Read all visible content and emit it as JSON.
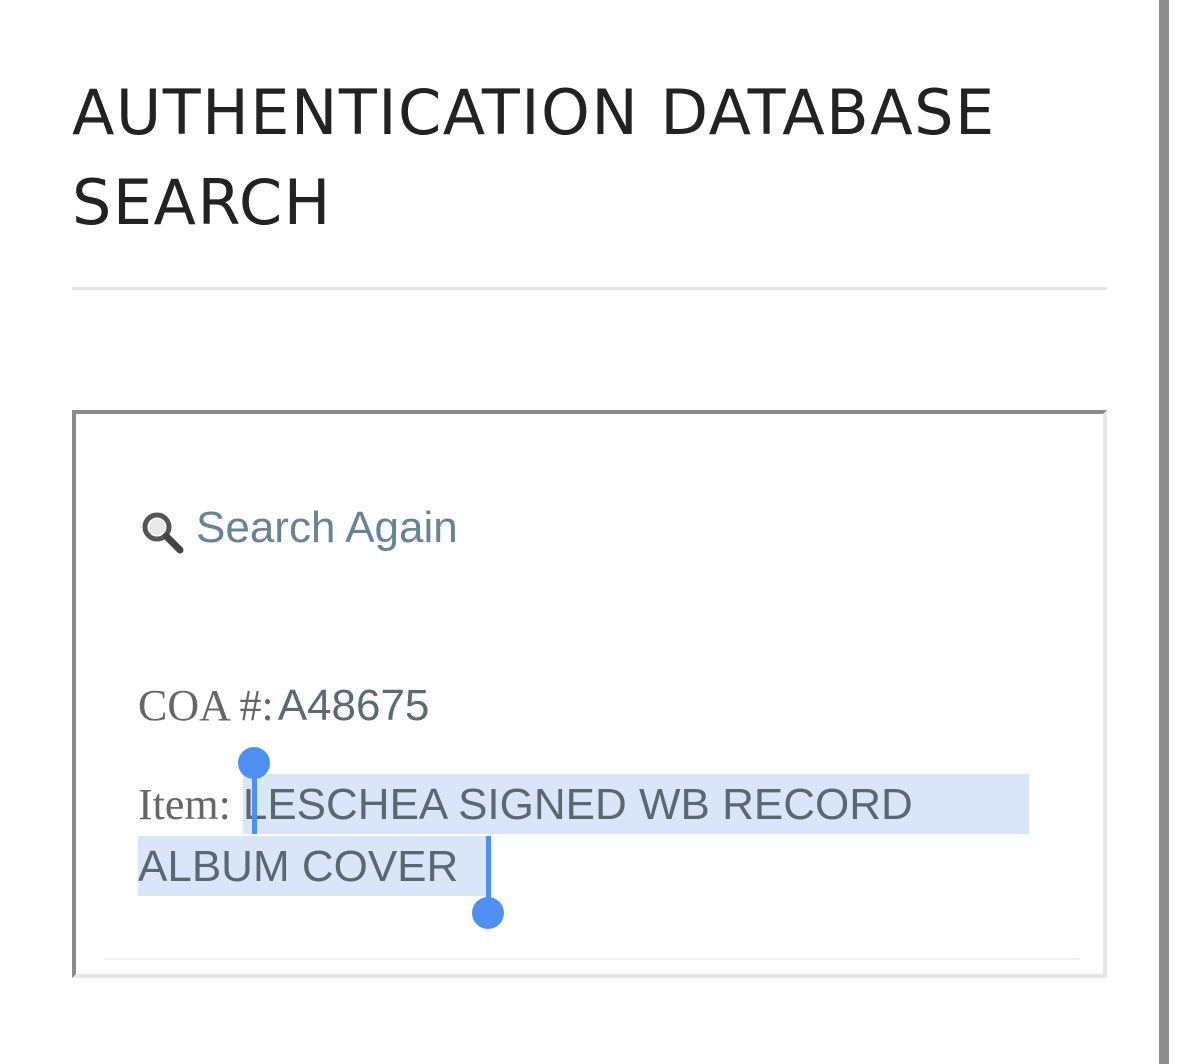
{
  "page": {
    "title": "AUTHENTICATION DATABASE SEARCH"
  },
  "result": {
    "search_again_label": "Search Again",
    "coa_label": "COA #:",
    "coa_value": "A48675",
    "item_label": "Item:",
    "item_value_line1": "LESCHEA SIGNED WB RECORD",
    "item_value_line2": "ALBUM COVER"
  },
  "icons": {
    "search": "search-icon"
  },
  "colors": {
    "link": "#6a8393",
    "selection_highlight": "#d9e6f8",
    "selection_handle": "#4f8ff0",
    "title_text": "#222222"
  }
}
